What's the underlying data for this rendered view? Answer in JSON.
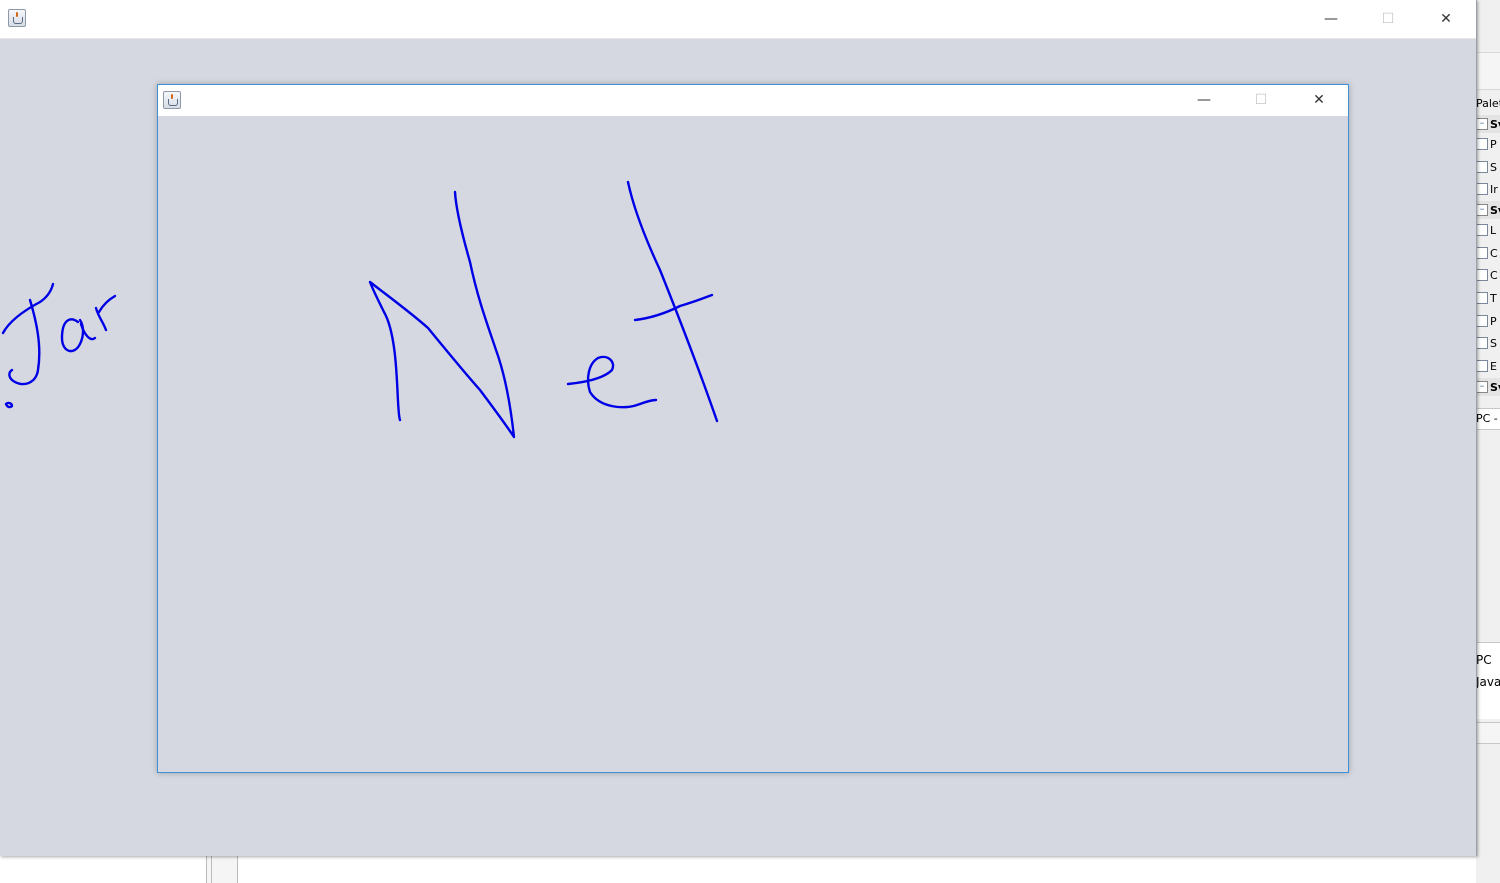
{
  "outer_window": {
    "title": "",
    "controls": {
      "minimize": "—",
      "maximize": "☐",
      "close": "✕"
    }
  },
  "inner_window": {
    "title": "",
    "controls": {
      "minimize": "—",
      "maximize": "☐",
      "close": "✕"
    }
  },
  "drawing": {
    "stroke_color": "#0000e6",
    "background_color": "#d5d8e0",
    "outer_strokes_label": "Jar",
    "inner_strokes_label": "Net"
  },
  "ide_background": {
    "palette_title": "Palet",
    "palette_items": [
      {
        "label": "Sv",
        "header": true,
        "icon": "minus"
      },
      {
        "label": "P",
        "header": false,
        "icon": "panel"
      },
      {
        "label": "S",
        "header": false,
        "icon": "split"
      },
      {
        "label": "Ir",
        "header": false,
        "icon": "frame"
      },
      {
        "label": "Sv",
        "header": true,
        "icon": "minus"
      },
      {
        "label": "L",
        "header": false,
        "icon": "label"
      },
      {
        "label": "C",
        "header": false,
        "icon": "combo"
      },
      {
        "label": "C",
        "header": false,
        "icon": "check"
      },
      {
        "label": "T",
        "header": false,
        "icon": "text"
      },
      {
        "label": "P",
        "header": false,
        "icon": "password"
      },
      {
        "label": "S",
        "header": false,
        "icon": "spinner"
      },
      {
        "label": "E",
        "header": false,
        "icon": "editor"
      },
      {
        "label": "Sv",
        "header": true,
        "icon": "minus"
      }
    ],
    "property_text": "PC -",
    "lower_panel_line1": "PC",
    "lower_panel_line2": "Java"
  }
}
